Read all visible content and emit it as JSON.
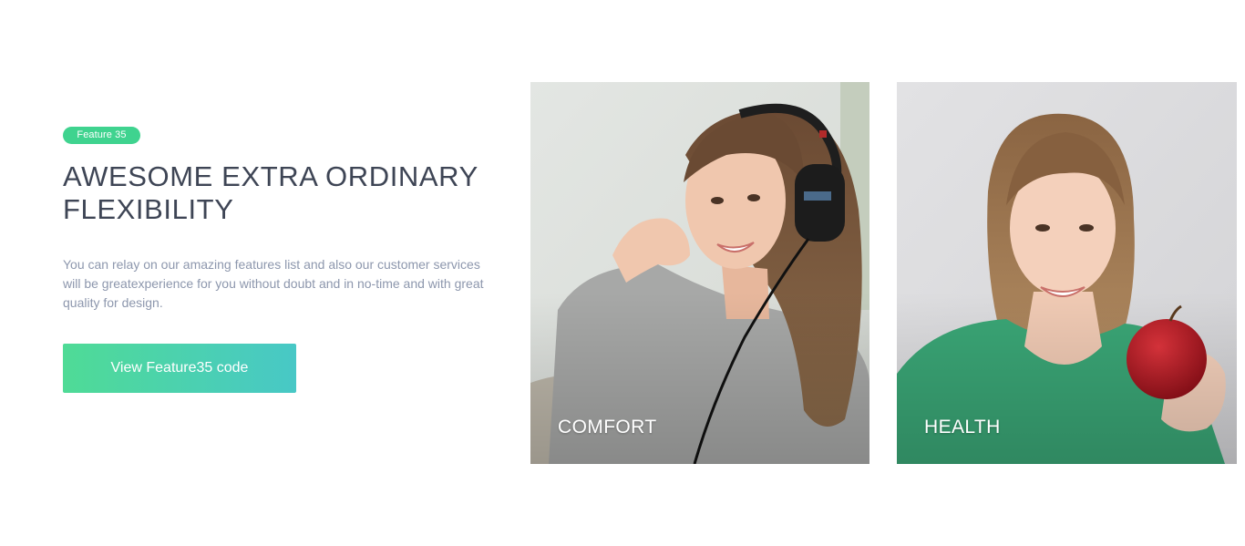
{
  "badge": {
    "label": "Feature 35"
  },
  "heading": {
    "line1": "AWESOME EXTRA ORDINARY",
    "line2": "FLEXIBILITY"
  },
  "description": "You can relay on our amazing features list and also our customer services will be greatexperience for you without doubt and in no-time and with great quality for design.",
  "cta": {
    "label": "View Feature35 code"
  },
  "cards": [
    {
      "label": "COMFORT",
      "image": "woman-with-headphones-photo"
    },
    {
      "label": "HEALTH",
      "image": "woman-holding-apple-photo"
    }
  ],
  "colors": {
    "badge": "#3fd38f",
    "heading": "#3e4555",
    "body_text": "#8d97ad",
    "cta_gradient_start": "#4fdb96",
    "cta_gradient_end": "#48c8c6"
  }
}
